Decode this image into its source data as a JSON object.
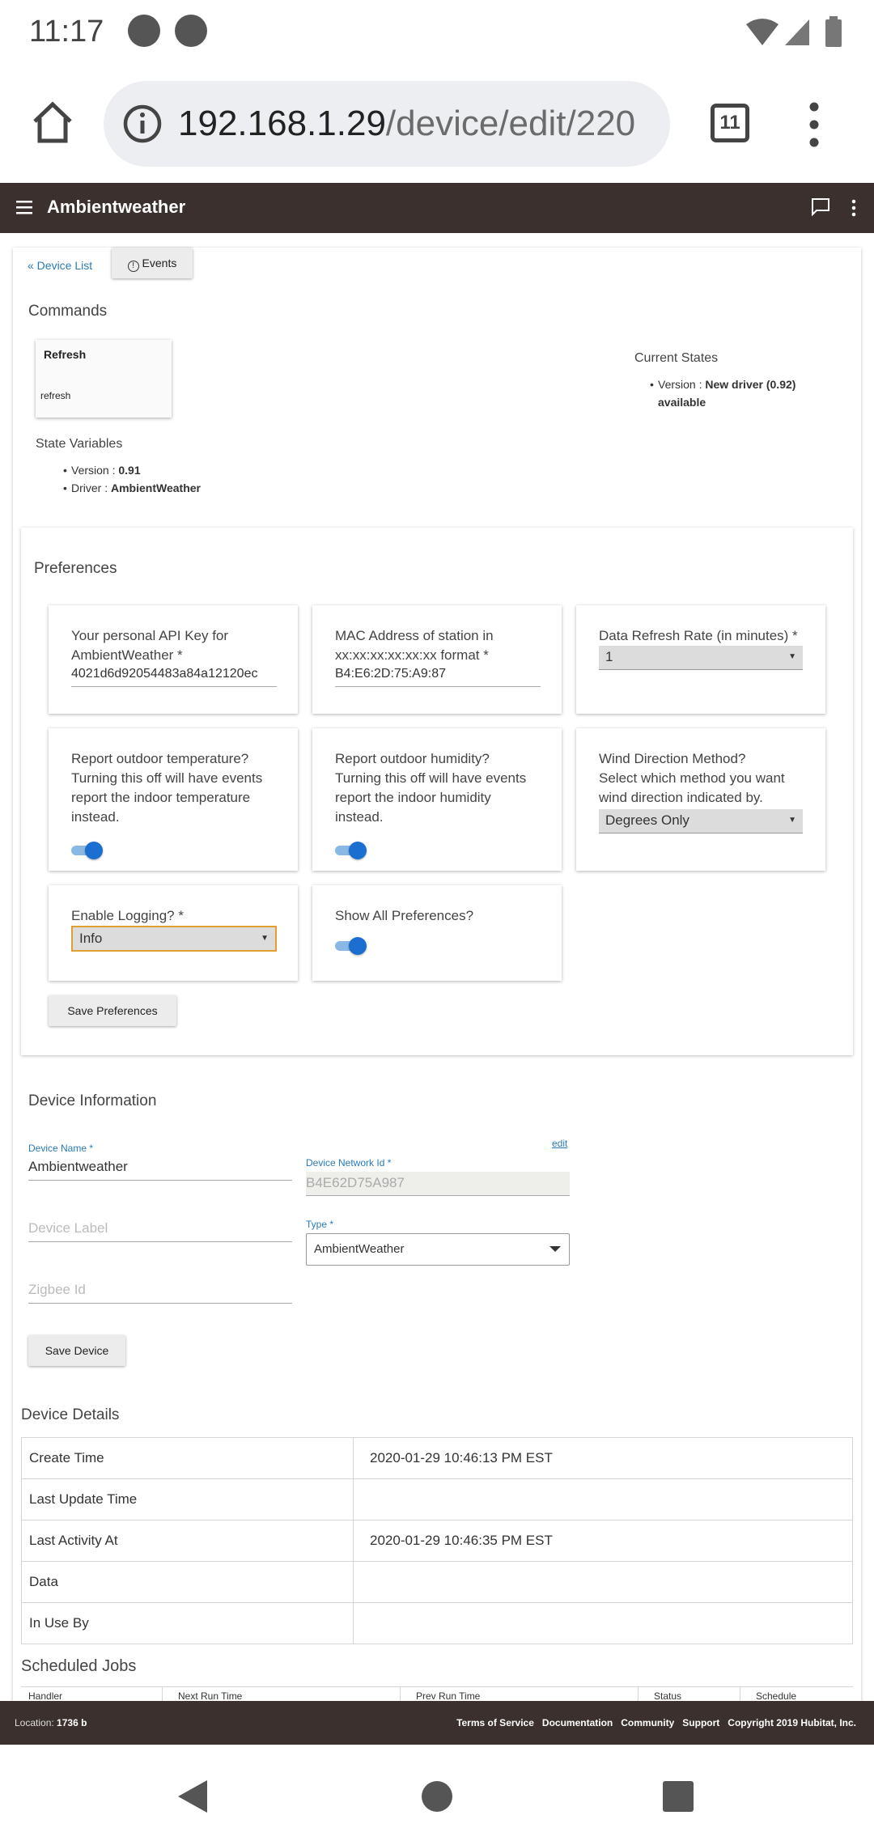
{
  "status_bar": {
    "time": "11:17"
  },
  "browser": {
    "url_host": "192.168.1.29",
    "url_path": "/device/edit/220",
    "tab_count": "11"
  },
  "app": {
    "title": "Ambientweather"
  },
  "nav": {
    "device_list_link": "« Device List",
    "events_button": "Events"
  },
  "commands": {
    "heading": "Commands",
    "refresh_title": "Refresh",
    "refresh_sub": "refresh"
  },
  "current_states": {
    "heading": "Current States",
    "version_label": "Version : ",
    "version_value_line1": "New driver (0.92)",
    "version_value_line2": "available"
  },
  "state_variables": {
    "heading": "State Variables",
    "items": [
      {
        "label": "Version : ",
        "value": "0.91"
      },
      {
        "label": "Driver : ",
        "value": "AmbientWeather"
      }
    ]
  },
  "preferences": {
    "heading": "Preferences",
    "api_key_label_1": "Your personal API Key for",
    "api_key_label_2": "AmbientWeather *",
    "api_key_value": "4021d6d92054483a84a12120ec",
    "mac_label_1": "MAC Address of station in",
    "mac_label_2": "xx:xx:xx:xx:xx:xx format *",
    "mac_value": "B4:E6:2D:75:A9:87",
    "refresh_rate_label": "Data Refresh Rate (in minutes) *",
    "refresh_rate_value": "1",
    "outdoor_temp_lines": [
      "Report outdoor temperature?",
      "Turning this off will have events",
      "report the indoor temperature",
      "instead."
    ],
    "outdoor_humidity_lines": [
      "Report outdoor humidity?",
      "Turning this off will have events",
      "report the indoor humidity",
      "instead."
    ],
    "wind_lines": [
      "Wind Direction Method?",
      "Select which method you want",
      "wind direction indicated by."
    ],
    "wind_value": "Degrees Only",
    "logging_label": "Enable Logging? *",
    "logging_value": "Info",
    "show_all_label": "Show All Preferences?",
    "save_button": "Save Preferences"
  },
  "device_info": {
    "heading": "Device Information",
    "name_label": "Device Name *",
    "name_value": "Ambientweather",
    "edit_link": "edit",
    "network_id_label": "Device Network Id *",
    "network_id_value": "B4E62D75A987",
    "label_placeholder": "Device Label",
    "type_label": "Type *",
    "type_value": "AmbientWeather",
    "zigbee_placeholder": "Zigbee Id",
    "save_button": "Save Device"
  },
  "device_details": {
    "heading": "Device Details",
    "rows": [
      {
        "label": "Create Time",
        "value": "2020-01-29 10:46:13 PM EST"
      },
      {
        "label": "Last Update Time",
        "value": ""
      },
      {
        "label": "Last Activity At",
        "value": "2020-01-29 10:46:35 PM EST"
      },
      {
        "label": "Data",
        "value": ""
      },
      {
        "label": "In Use By",
        "value": ""
      }
    ]
  },
  "scheduled_jobs": {
    "heading": "Scheduled Jobs",
    "columns": [
      "Handler",
      "Next Run Time",
      "Prev Run Time",
      "Status",
      "Schedule"
    ]
  },
  "footer": {
    "location_label": "Location: ",
    "location_value": "1736 b",
    "links": [
      "Terms of Service",
      "Documentation",
      "Community",
      "Support"
    ],
    "copyright": "Copyright 2019 Hubitat, Inc."
  },
  "colors": {
    "header_bg": "#3b302d",
    "link": "#2a7ab8",
    "toggle_on": "#1a6fd0",
    "focus_border": "#e0a030"
  }
}
